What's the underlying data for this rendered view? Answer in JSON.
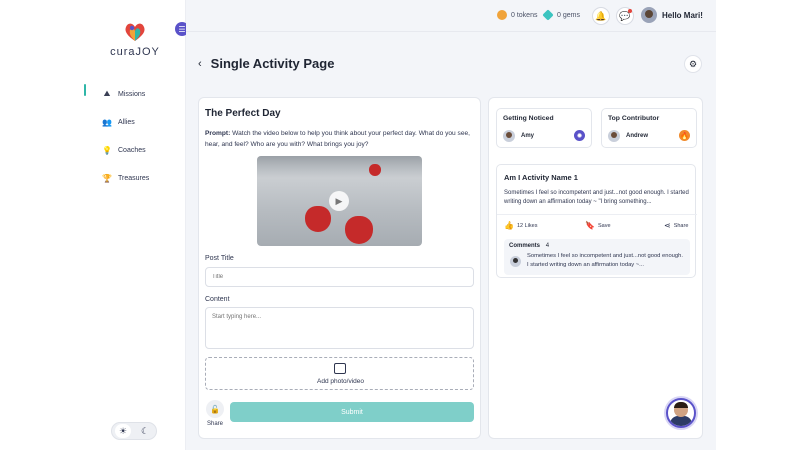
{
  "brand": {
    "logo_text": "curaJOY",
    "accent": "#5a52c9",
    "teal": "#7fcfc9"
  },
  "topbar": {
    "tokens": "0 tokens",
    "gems": "0 gems",
    "greeting": "Hello Mari!"
  },
  "sidebar": {
    "items": [
      {
        "label": "Missions",
        "icon": "missions-icon",
        "active": true
      },
      {
        "label": "Allies",
        "icon": "allies-icon",
        "active": false
      },
      {
        "label": "Coaches",
        "icon": "coaches-icon",
        "active": false
      },
      {
        "label": "Treasures",
        "icon": "treasures-icon",
        "active": false
      }
    ],
    "theme": {
      "light": "☀",
      "dark": "☾"
    }
  },
  "page": {
    "title": "Single Activity Page"
  },
  "activity": {
    "title": "The Perfect Day",
    "prompt_label": "Prompt:",
    "prompt_text": "Watch the video below to help you think about your perfect day. What do you see, hear, and feel? Who are you with? What brings you joy?",
    "post_title_label": "Post Title",
    "post_title_placeholder": "Title",
    "content_label": "Content",
    "content_placeholder": "Start typing here...",
    "add_media_label": "Add photo/video",
    "share_label": "Share",
    "submit_label": "Submit"
  },
  "highlights": {
    "getting_noticed": {
      "title": "Getting Noticed",
      "user": "Amy"
    },
    "top_contributor": {
      "title": "Top Contributor",
      "user": "Andrew"
    }
  },
  "post": {
    "title": "Am I Activity Name 1",
    "body": "Sometimes I feel so incompetent and just...not good enough. I started writing down an affirmation today ~ \"I bring something...",
    "likes": "12 Likes",
    "save": "Save",
    "share": "Share",
    "comments_label": "Comments",
    "comments_count": "4",
    "comment_text": "Sometimes I feel so incompetent and just...not good enough. I started writing down an affirmation today ~..."
  }
}
